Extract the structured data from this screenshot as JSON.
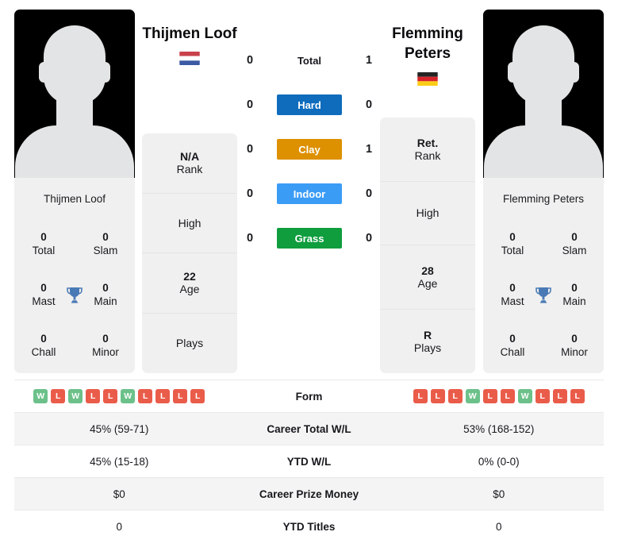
{
  "players": {
    "left": {
      "name": "Thijmen Loof",
      "card_name": "Thijmen Loof",
      "country": "Netherlands",
      "flag": "nl-flag-icon",
      "rank": "N/A",
      "rank_label": "Rank",
      "high_value": "",
      "high_label": "High",
      "age": "22",
      "age_label": "Age",
      "plays": "",
      "plays_label": "Plays",
      "titles": {
        "total": "0",
        "total_label": "Total",
        "slam": "0",
        "slam_label": "Slam",
        "mast": "0",
        "mast_label": "Mast",
        "main": "0",
        "main_label": "Main",
        "chall": "0",
        "chall_label": "Chall",
        "minor": "0",
        "minor_label": "Minor"
      },
      "form": [
        "W",
        "L",
        "W",
        "L",
        "L",
        "W",
        "L",
        "L",
        "L",
        "L"
      ],
      "career_total_wl": "45% (59-71)",
      "ytd_wl": "45% (15-18)",
      "career_prize_money": "$0",
      "ytd_titles": "0"
    },
    "right": {
      "name": "Flemming Peters",
      "card_name": "Flemming Peters",
      "country": "Germany",
      "flag": "de-flag-icon",
      "rank": "Ret.",
      "rank_label": "Rank",
      "high_value": "",
      "high_label": "High",
      "age": "28",
      "age_label": "Age",
      "plays": "R",
      "plays_label": "Plays",
      "titles": {
        "total": "0",
        "total_label": "Total",
        "slam": "0",
        "slam_label": "Slam",
        "mast": "0",
        "mast_label": "Mast",
        "main": "0",
        "main_label": "Main",
        "chall": "0",
        "chall_label": "Chall",
        "minor": "0",
        "minor_label": "Minor"
      },
      "form": [
        "L",
        "L",
        "L",
        "W",
        "L",
        "L",
        "W",
        "L",
        "L",
        "L"
      ],
      "career_total_wl": "53% (168-152)",
      "ytd_wl": "0% (0-0)",
      "career_prize_money": "$0",
      "ytd_titles": "0"
    }
  },
  "head_to_head": [
    {
      "label": "Total",
      "left": "0",
      "right": "1",
      "color": "none",
      "plain": true
    },
    {
      "label": "Hard",
      "left": "0",
      "right": "0",
      "color": "#0f6cbd",
      "plain": false
    },
    {
      "label": "Clay",
      "left": "0",
      "right": "1",
      "color": "#dd9000",
      "plain": false
    },
    {
      "label": "Indoor",
      "left": "0",
      "right": "0",
      "color": "#3b9cf5",
      "plain": false
    },
    {
      "label": "Grass",
      "left": "0",
      "right": "0",
      "color": "#0f9d3e",
      "plain": false
    }
  ],
  "table_rows": [
    {
      "label": "Form",
      "type": "form"
    },
    {
      "label": "Career Total W/L",
      "type": "text",
      "key": "career_total_wl"
    },
    {
      "label": "YTD W/L",
      "type": "text",
      "key": "ytd_wl"
    },
    {
      "label": "Career Prize Money",
      "type": "text",
      "key": "career_prize_money"
    },
    {
      "label": "YTD Titles",
      "type": "text",
      "key": "ytd_titles"
    }
  ],
  "colors": {
    "win": "#6cc18a",
    "loss": "#ea5c4a",
    "trophy": "#4a7ab5",
    "panel": "#f0f0f0",
    "row_alt": "#f4f4f4"
  },
  "icons": {
    "trophy": "trophy-icon"
  }
}
